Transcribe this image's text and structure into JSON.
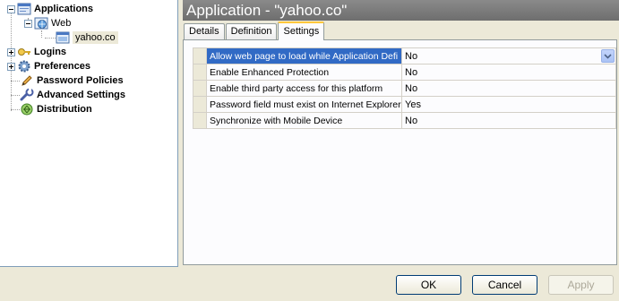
{
  "tree": {
    "applications": "Applications",
    "web": "Web",
    "yahoo": "yahoo.co",
    "logins": "Logins",
    "preferences": "Preferences",
    "password_policies": "Password Policies",
    "advanced_settings": "Advanced Settings",
    "distribution": "Distribution"
  },
  "header": {
    "title": "Application - \"yahoo.co\""
  },
  "tabs": [
    {
      "label": "Details"
    },
    {
      "label": "Definition"
    },
    {
      "label": "Settings"
    }
  ],
  "settings": [
    {
      "name": "Allow web page to load while Application Defi",
      "value": "No"
    },
    {
      "name": "Enable Enhanced Protection",
      "value": "No"
    },
    {
      "name": "Enable third party access for this platform",
      "value": "No"
    },
    {
      "name": "Password field must exist on Internet Explorer",
      "value": "Yes"
    },
    {
      "name": "Synchronize with Mobile Device",
      "value": "No"
    }
  ],
  "buttons": {
    "ok": "OK",
    "cancel": "Cancel",
    "apply": "Apply"
  }
}
